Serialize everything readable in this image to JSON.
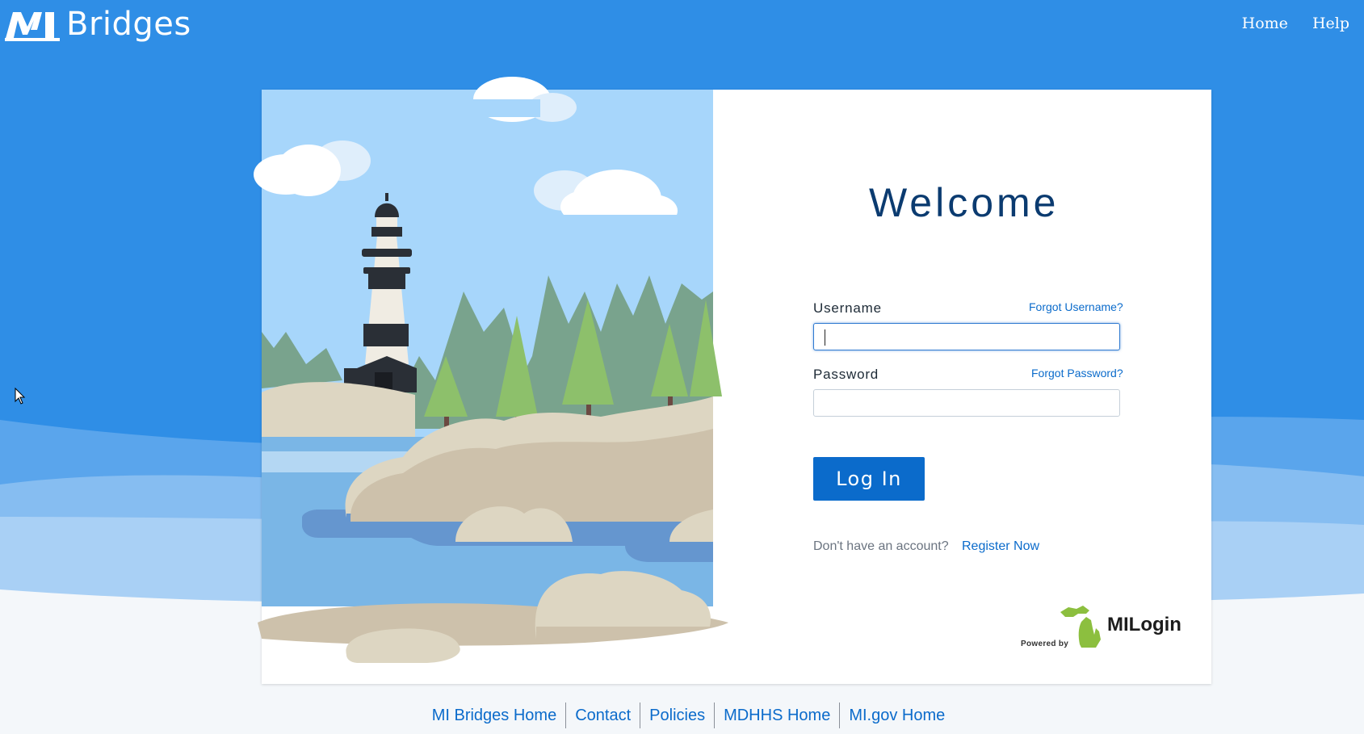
{
  "header": {
    "logo_mark": "MI",
    "logo_text": "Bridges",
    "nav": [
      {
        "label": "Home"
      },
      {
        "label": "Help"
      }
    ]
  },
  "login": {
    "welcome": "Welcome",
    "username_label": "Username",
    "forgot_username": "Forgot Username?",
    "username_value": "",
    "password_label": "Password",
    "forgot_password": "Forgot Password?",
    "password_value": "",
    "login_button": "Log In",
    "no_account_text": "Don't have an account?",
    "register_link": "Register Now",
    "powered_by": "Powered by",
    "provider_name": "MILogin"
  },
  "footer": {
    "links": [
      {
        "label": "MI Bridges Home"
      },
      {
        "label": "Contact"
      },
      {
        "label": "Policies"
      },
      {
        "label": "MDHHS Home"
      },
      {
        "label": "MI.gov Home"
      }
    ]
  },
  "colors": {
    "background_blue": "#2f8ee6",
    "primary_button": "#0b6bcb",
    "link": "#0b6bcb",
    "heading": "#0b3b70",
    "milogin_green": "#8cbf3f"
  }
}
